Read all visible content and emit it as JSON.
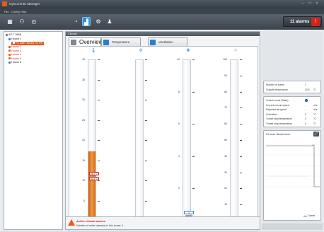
{
  "window": {
    "title": "myCurrentC Manager",
    "controls": [
      "–",
      "□",
      "×"
    ]
  },
  "menu": [
    "File",
    "Config",
    "Help"
  ],
  "toolbar": {
    "alarms_label": "11 alarms"
  },
  "tree": {
    "root": "AP-7 9696",
    "items": [
      {
        "label": "House 1",
        "color": "#2c7fc7",
        "level": 1
      },
      {
        "label": "FC 9857 Smart 1/1 FD",
        "color": "#e85b1c",
        "level": 2,
        "selected": true
      },
      {
        "label": "House 2",
        "color": "#e85b1c",
        "level": 1
      },
      {
        "label": "House 3",
        "color": "#e85b1c",
        "level": 1
      },
      {
        "label": "House 4",
        "color": "#e85b1c",
        "level": 1
      },
      {
        "label": "House 5",
        "color": "#e85b1c",
        "level": 1
      },
      {
        "label": "House 6",
        "color": "#2c7fc7",
        "level": 1
      }
    ]
  },
  "main": {
    "header": "Climate",
    "tabs": [
      {
        "label": "Overview",
        "active": true
      },
      {
        "label": "Temperature",
        "active": false
      },
      {
        "label": "Ventilation",
        "active": false
      }
    ]
  },
  "gauges": [
    {
      "icon": "thermometer-icon",
      "icon_glyph": "🌡",
      "ticks": [
        "40",
        "35",
        "30",
        "25",
        "20",
        "15",
        "10",
        "5",
        "0"
      ],
      "fill_fraction": 0.43,
      "bubbles": [
        {
          "text": "20.7°C",
          "style": "red",
          "at": 0.29
        },
        {
          "text": "20.1°C",
          "style": "red",
          "at": 0.26
        }
      ],
      "footer": "27.3°C"
    },
    {
      "icon": "fan-icon",
      "icon_glyph": "✣",
      "ticks": [
        "",
        "",
        "",
        "",
        "",
        "",
        "",
        "",
        ""
      ],
      "fill_fraction": 0,
      "bubbles": [],
      "footer": ""
    },
    {
      "icon": "heater-icon",
      "icon_glyph": "✚",
      "ticks": [
        "10",
        "8",
        "6",
        "4",
        "2",
        "0"
      ],
      "fill_fraction": 0,
      "bubbles": [
        {
          "text": "1 dam³/h",
          "style": "blue",
          "at": 0.05
        }
      ],
      "footer": "0%"
    },
    {
      "icon": "house-icon",
      "icon_glyph": "⌂",
      "ticks": [
        "100",
        "90",
        "80",
        "70",
        "60",
        "50",
        "40",
        "30",
        "20",
        "10",
        "0"
      ],
      "fill_fraction": 0,
      "bubbles": [],
      "footer": "0%"
    }
  ],
  "alarm": {
    "title": "Active climate alarms",
    "text": "Number of active alarm(s) in this house: 1"
  },
  "info_card": {
    "rows": [
      {
        "label": "Number of zones",
        "value": "1",
        "unit": ""
      },
      {
        "label": "Outside temperature",
        "value": "20.9",
        "unit": "°C"
      }
    ]
  },
  "control_card": {
    "rows": [
      {
        "label": "Control mode (State)",
        "value": "",
        "unit": "",
        "radio": true
      },
      {
        "label": "Current min air speed",
        "value": "-",
        "unit": "m/s"
      },
      {
        "label": "Required air speed",
        "value": "-",
        "unit": "m/s"
      },
      {
        "label": "Chill effect",
        "value": "0",
        "unit": "°C"
      },
      {
        "label": "Tunnel start temperature",
        "value": "0",
        "unit": "°C"
      },
      {
        "label": "Tunnel stop temperature",
        "value": "0",
        "unit": "°C"
      }
    ]
  },
  "trend_card": {
    "title": "24 hours climate trend",
    "legend": "Tunnel"
  }
}
